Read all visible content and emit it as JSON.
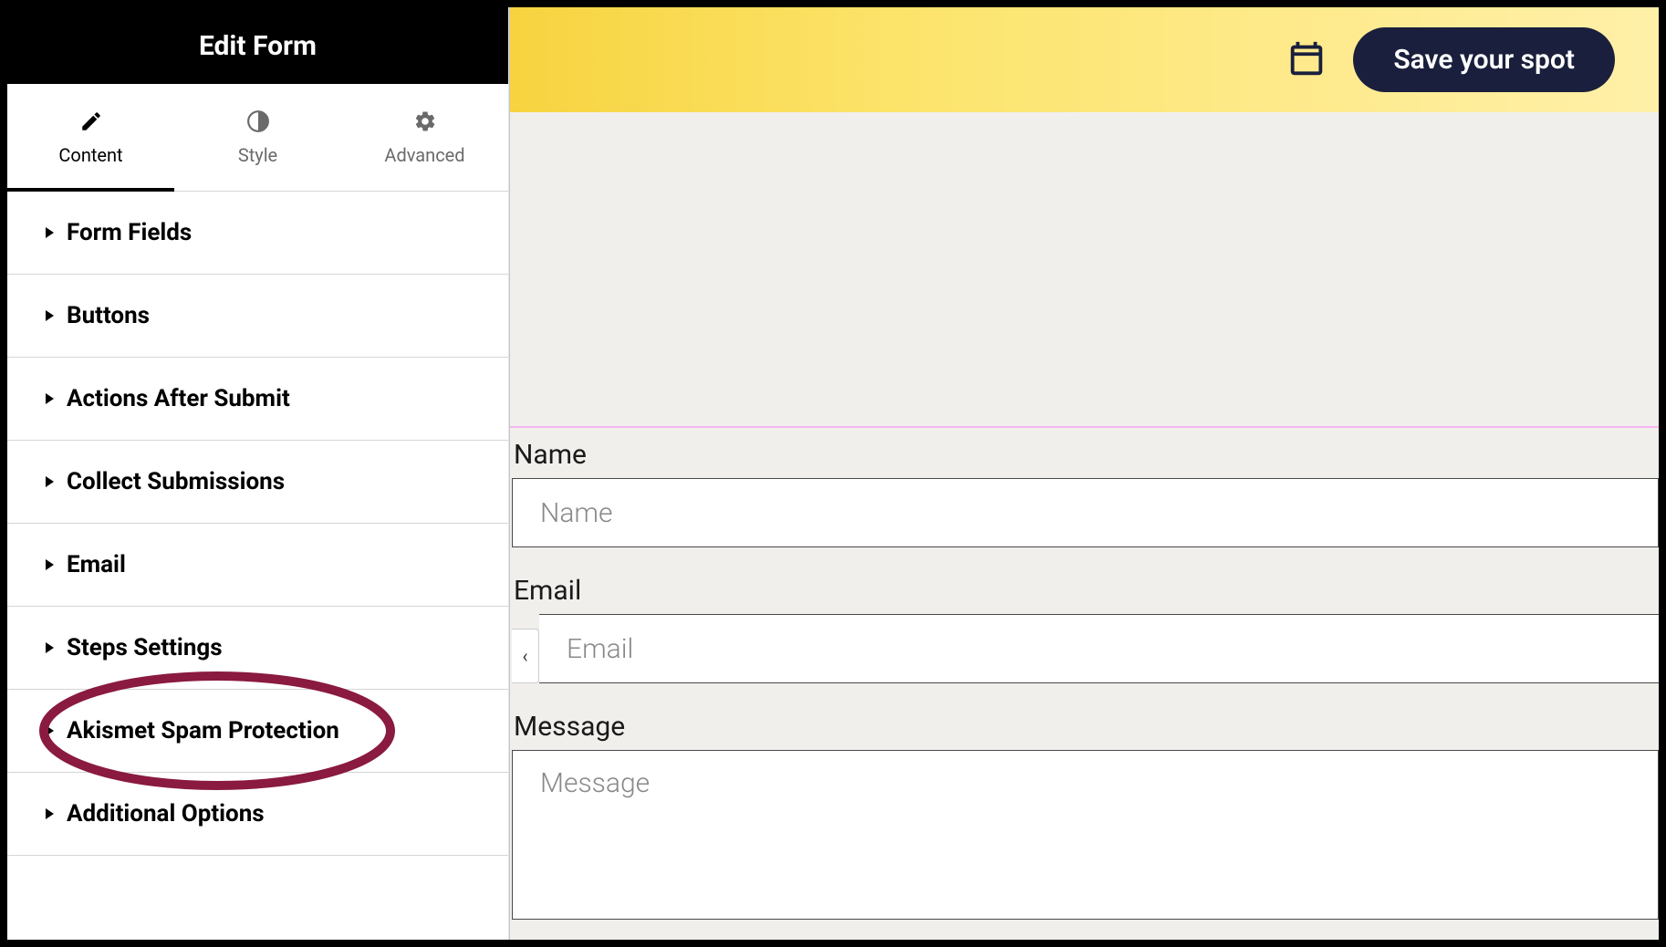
{
  "sidebar": {
    "title": "Edit Form",
    "tabs": [
      {
        "label": "Content",
        "icon": "pencil-icon"
      },
      {
        "label": "Style",
        "icon": "half-circle-icon"
      },
      {
        "label": "Advanced",
        "icon": "gear-icon"
      }
    ],
    "sections": [
      {
        "label": "Form Fields"
      },
      {
        "label": "Buttons"
      },
      {
        "label": "Actions After Submit"
      },
      {
        "label": "Collect Submissions"
      },
      {
        "label": "Email"
      },
      {
        "label": "Steps Settings"
      },
      {
        "label": "Akismet Spam Protection",
        "highlighted": true
      },
      {
        "label": "Additional Options"
      }
    ]
  },
  "topbar": {
    "cta_label": "Save your spot"
  },
  "collapse_handle": {
    "glyph": "‹"
  },
  "form": {
    "name": {
      "label": "Name",
      "placeholder": "Name",
      "value": ""
    },
    "email": {
      "label": "Email",
      "placeholder": "Email",
      "value": ""
    },
    "message": {
      "label": "Message",
      "placeholder": "Message",
      "value": ""
    }
  }
}
